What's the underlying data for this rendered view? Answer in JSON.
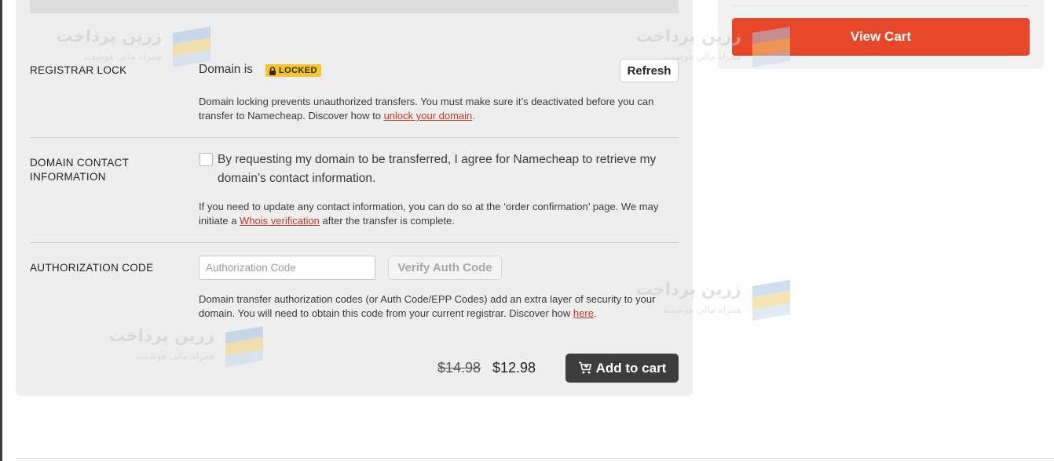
{
  "registrar_lock": {
    "label": "REGISTRAR LOCK",
    "status_prefix": "Domain is",
    "badge": "LOCKED",
    "refresh_label": "Refresh",
    "help_text": "Domain locking prevents unauthorized transfers. You must make sure it’s deactivated before you can transfer to Namecheap. Discover how to",
    "help_link": "unlock your domain",
    "help_suffix": "."
  },
  "contact_info": {
    "label_line1": "DOMAIN CONTACT",
    "label_line2": "INFORMATION",
    "checkbox_checked": false,
    "agree_text": "By requesting my domain to be transferred, I agree for Namecheap to retrieve my domain’s contact information.",
    "help_text": "If you need to update any contact information, you can do so at the ‘order confirmation’ page. We may initiate a",
    "help_link": "Whois verification",
    "help_suffix": "after the transfer is complete."
  },
  "auth_code": {
    "label": "AUTHORIZATION CODE",
    "placeholder": "Authorization Code",
    "value": "",
    "verify_label": "Verify Auth Code",
    "help_text": "Domain transfer authorization codes (or Auth Code/EPP Codes) add an extra layer of security to your domain. You will need to obtain this code from your current registrar. Discover how",
    "help_link": "here",
    "help_suffix": "."
  },
  "pricing": {
    "old_price": "$14.98",
    "new_price": "$12.98",
    "add_to_cart_label": "Add to cart"
  },
  "cart": {
    "view_cart_label": "View Cart"
  },
  "watermark": {
    "title": "زرین پرداخت",
    "subtitle": "همراه مالی هوشمند"
  },
  "colors": {
    "accent": "#e8482a",
    "link": "#c0392b",
    "badge": "#f6c52b",
    "dark_button": "#3d3d3d"
  }
}
